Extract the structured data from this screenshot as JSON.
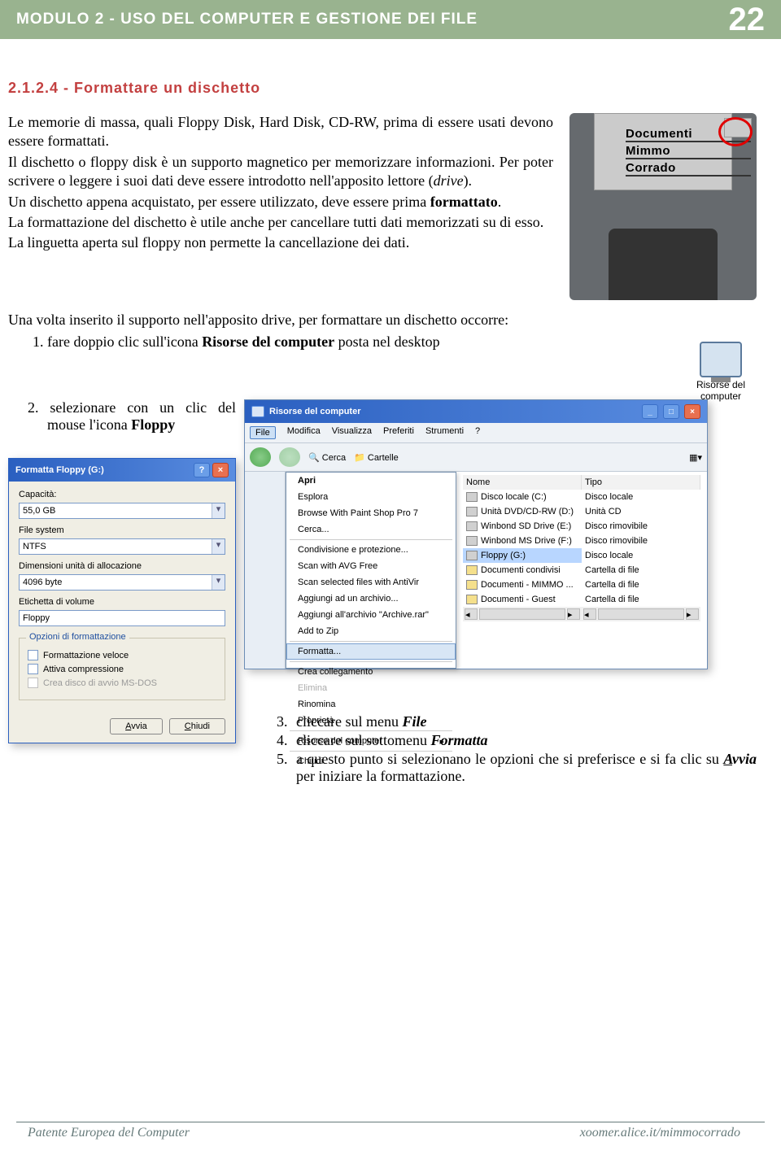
{
  "header": {
    "title": "MODULO 2 -  USO DEL COMPUTER E GESTIONE DEI FILE",
    "page": "22"
  },
  "section_title": "2.1.2.4 - Formattare un dischetto",
  "intro": {
    "p1a": "Le memorie di massa, quali Floppy Disk, Hard Disk, CD-RW, prima di essere usati devono essere formattati.",
    "p2a": "Il dischetto o floppy disk è un supporto magnetico per memorizzare informazioni. Per poter scrivere o leggere i suoi dati deve essere introdotto nell'apposito lettore (",
    "p2b": "drive",
    "p2c": ").",
    "p3a": "Un dischetto appena acquistato, per essere utilizzato, deve essere prima ",
    "p3b": "formattato",
    "p3c": ".",
    "p4": "La formattazione del dischetto è utile anche per cancellare tutti dati memorizzati su di esso.",
    "p5": "La linguetta aperta sul floppy non permette la cancellazione dei dati."
  },
  "floppy": {
    "l1": "Documenti",
    "l2": "Mimmo",
    "l3": "Corrado"
  },
  "step_intro": "Una volta inserito il supporto nell'apposito drive, per formattare un dischetto occorre:",
  "step1_a": "fare doppio clic sull'icona ",
  "step1_b": "Risorse del computer",
  "step1_c": " posta nel desktop",
  "risorse_label1": "Risorse del",
  "risorse_label2": "computer",
  "step2_a": "2.  selezionare con un clic del mouse l'icona ",
  "step2_b": "Floppy",
  "explorer": {
    "title": "Risorse del computer",
    "menu": [
      "File",
      "Modifica",
      "Visualizza",
      "Preferiti",
      "Strumenti",
      "?"
    ],
    "tool": {
      "search": "Cerca",
      "folders": "Cartelle"
    },
    "ctx": [
      "Apri",
      "Esplora",
      "Browse With Paint Shop Pro 7",
      "Cerca...",
      "Condivisione e protezione...",
      "Scan with AVG Free",
      "Scan selected files with AntiVir",
      "Aggiungi ad un archivio...",
      "Aggiungi all'archivio \"Archive.rar\"",
      "Add to Zip",
      "Formatta...",
      "Crea collegamento",
      "Elimina",
      "Rinomina",
      "Proprietà",
      "Risorse del computer",
      "Chiudi"
    ],
    "col1": "Nome",
    "col2": "Tipo",
    "drives": [
      [
        "Disco locale (C:)",
        "Disco locale"
      ],
      [
        "Unità DVD/CD-RW (D:)",
        "Unità CD"
      ],
      [
        "Winbond SD Drive (E:)",
        "Disco rimovibile"
      ],
      [
        "Winbond MS Drive (F:)",
        "Disco rimovibile"
      ],
      [
        "Floppy (G:)",
        "Disco locale"
      ],
      [
        "Documenti condivisi",
        "Cartella di file"
      ],
      [
        "Documenti - MIMMO ...",
        "Cartella di file"
      ],
      [
        "Documenti - Guest",
        "Cartella di file"
      ]
    ]
  },
  "format": {
    "title": "Formatta Floppy (G:)",
    "cap_lbl": "Capacità:",
    "cap_val": "55,0 GB",
    "fs_lbl": "File system",
    "fs_val": "NTFS",
    "dim_lbl": "Dimensioni unità di allocazione",
    "dim_val": "4096 byte",
    "etch_lbl": "Etichetta di volume",
    "etch_val": "Floppy",
    "opts_lbl": "Opzioni di formattazione",
    "opt1": "Formattazione veloce",
    "opt2": "Attiva compressione",
    "opt3": "Crea disco di avvio MS-DOS",
    "avvia": "Avvia",
    "chiudi": "Chiudi"
  },
  "step3_a": "cliccare sul menu ",
  "step3_b": "File",
  "step4_a": "cliccare sul sottomenu ",
  "step4_b": "Formatta",
  "step5_a": "a questo punto si selezionano le opzioni che si preferisce e si fa clic su ",
  "step5_b": "Avvia",
  "step5_c": " per iniziare la formattazione.",
  "footer": {
    "left": "Patente Europea del Computer",
    "right": "xoomer.alice.it/mimmocorrado"
  }
}
